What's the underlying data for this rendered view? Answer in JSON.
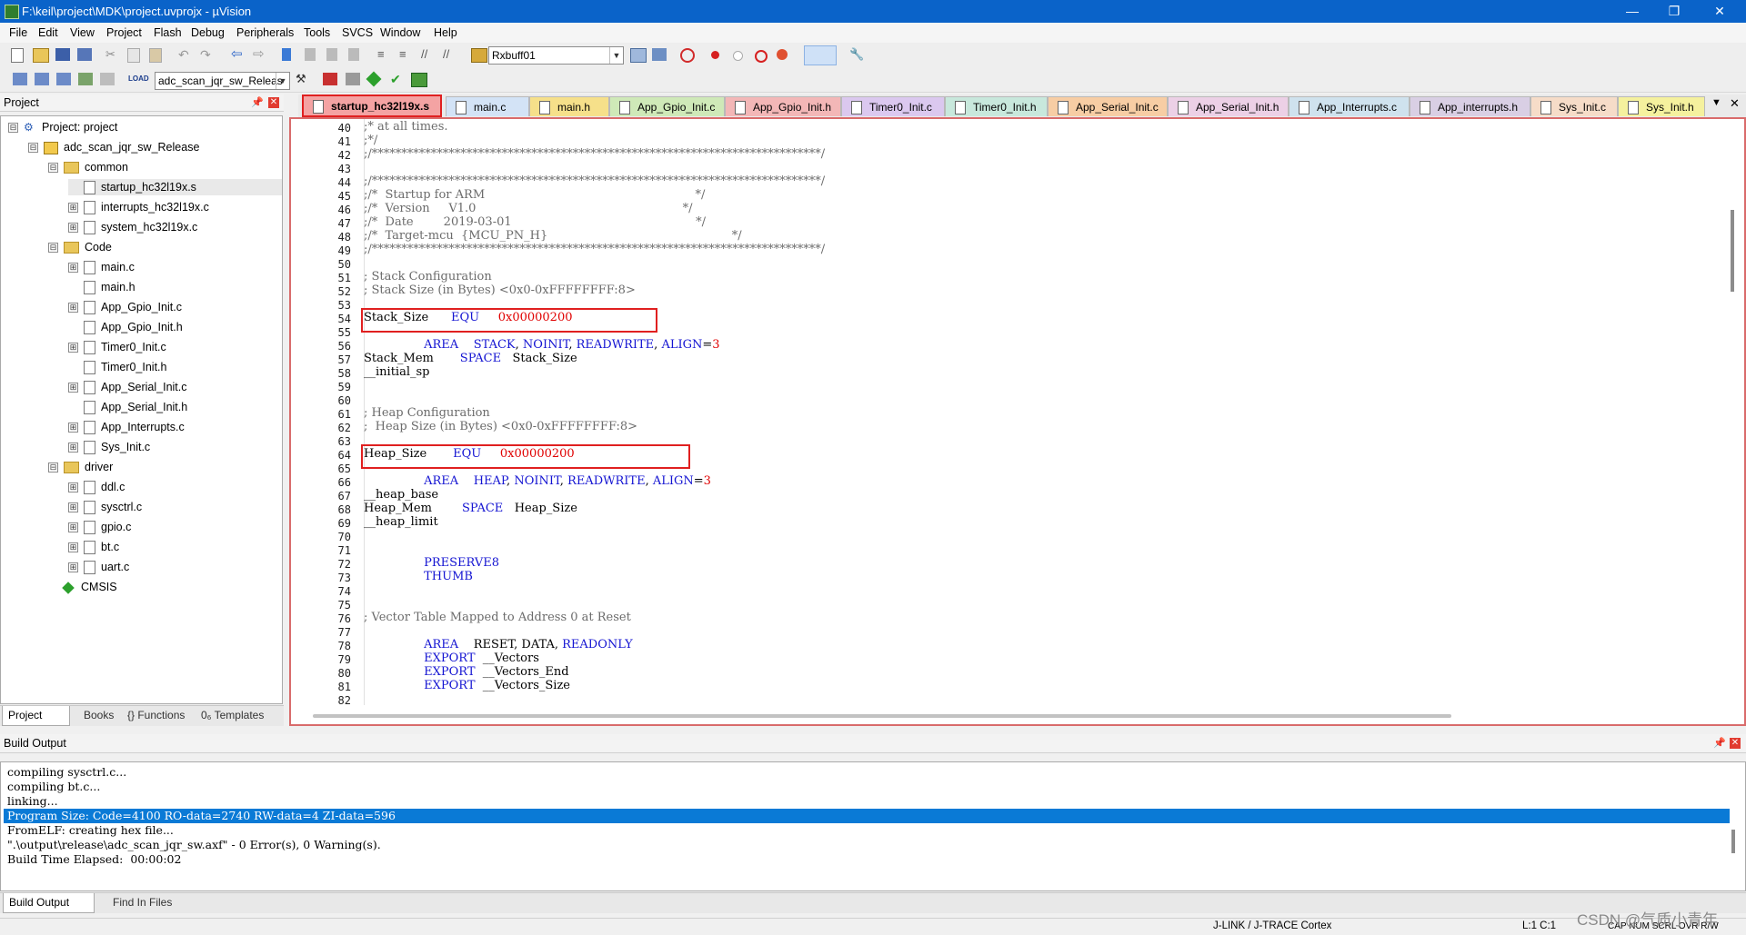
{
  "window": {
    "title": "F:\\keil\\project\\MDK\\project.uvprojx - µVision",
    "minimize": "—",
    "maximize": "❐",
    "close": "✕"
  },
  "menu": [
    "File",
    "Edit",
    "View",
    "Project",
    "Flash",
    "Debug",
    "Peripherals",
    "Tools",
    "SVCS",
    "Window",
    "Help"
  ],
  "toolbar1": {
    "find_value": "Rxbuff01"
  },
  "toolbar2": {
    "target_value": "adc_scan_jqr_sw_Releas",
    "load_label": "LOAD"
  },
  "project_panel": {
    "title": "Project",
    "tree": [
      {
        "label": "Project: project",
        "kind": "project",
        "expander": "⊟"
      },
      {
        "label": "adc_scan_jqr_sw_Release",
        "kind": "target",
        "expander": "⊟"
      },
      {
        "label": "common",
        "kind": "folder",
        "expander": "⊟"
      },
      {
        "label": "startup_hc32l19x.s",
        "kind": "file",
        "expander": ""
      },
      {
        "label": "interrupts_hc32l19x.c",
        "kind": "file",
        "expander": "⊞"
      },
      {
        "label": "system_hc32l19x.c",
        "kind": "file",
        "expander": "⊞"
      },
      {
        "label": "Code",
        "kind": "folder",
        "expander": "⊟"
      },
      {
        "label": "main.c",
        "kind": "file",
        "expander": "⊞"
      },
      {
        "label": "main.h",
        "kind": "file",
        "expander": ""
      },
      {
        "label": "App_Gpio_Init.c",
        "kind": "file",
        "expander": "⊞"
      },
      {
        "label": "App_Gpio_Init.h",
        "kind": "file",
        "expander": ""
      },
      {
        "label": "Timer0_Init.c",
        "kind": "file",
        "expander": "⊞"
      },
      {
        "label": "Timer0_Init.h",
        "kind": "file",
        "expander": ""
      },
      {
        "label": "App_Serial_Init.c",
        "kind": "file",
        "expander": "⊞"
      },
      {
        "label": "App_Serial_Init.h",
        "kind": "file",
        "expander": ""
      },
      {
        "label": "App_Interrupts.c",
        "kind": "file",
        "expander": "⊞"
      },
      {
        "label": "Sys_Init.c",
        "kind": "file",
        "expander": "⊞"
      },
      {
        "label": "driver",
        "kind": "folder",
        "expander": "⊟"
      },
      {
        "label": "ddl.c",
        "kind": "file",
        "expander": "⊞"
      },
      {
        "label": "sysctrl.c",
        "kind": "file",
        "expander": "⊞"
      },
      {
        "label": "gpio.c",
        "kind": "file",
        "expander": "⊞"
      },
      {
        "label": "bt.c",
        "kind": "file",
        "expander": "⊞"
      },
      {
        "label": "uart.c",
        "kind": "file",
        "expander": "⊞"
      },
      {
        "label": "CMSIS",
        "kind": "cmsis",
        "expander": ""
      }
    ],
    "bottom_tabs": [
      "Project",
      "Books",
      "{} Functions",
      "0₆ Templates"
    ]
  },
  "file_tabs": [
    {
      "label": "startup_hc32l19x.s",
      "color": "#f4a3a3",
      "active": true
    },
    {
      "label": "main.c",
      "color": "#d3e3f6"
    },
    {
      "label": "main.h",
      "color": "#f6e08a"
    },
    {
      "label": "App_Gpio_Init.c",
      "color": "#cfe9b8"
    },
    {
      "label": "App_Gpio_Init.h",
      "color": "#f3b7b7"
    },
    {
      "label": "Timer0_Init.c",
      "color": "#dbc8ef"
    },
    {
      "label": "Timer0_Init.h",
      "color": "#c8e8dc"
    },
    {
      "label": "App_Serial_Init.c",
      "color": "#f7cda4"
    },
    {
      "label": "App_Serial_Init.h",
      "color": "#ecd0e6"
    },
    {
      "label": "App_Interrupts.c",
      "color": "#cfe2ee"
    },
    {
      "label": "App_interrupts.h",
      "color": "#d9cfe4"
    },
    {
      "label": "Sys_Init.c",
      "color": "#f6dcc8"
    },
    {
      "label": "Sys_Init.h",
      "color": "#f5f19e"
    }
  ],
  "editor": {
    "lines": [
      {
        "n": "40",
        "parts": [
          {
            "t": ";* at all times.",
            "c": "cm"
          }
        ]
      },
      {
        "n": "41",
        "parts": [
          {
            "t": ";*/",
            "c": "cm"
          }
        ]
      },
      {
        "n": "42",
        "parts": [
          {
            "t": ";/****************************************************************************/",
            "c": "cm"
          }
        ]
      },
      {
        "n": "43",
        "parts": []
      },
      {
        "n": "44",
        "parts": [
          {
            "t": ";/****************************************************************************/",
            "c": "cm"
          }
        ]
      },
      {
        "n": "45",
        "parts": [
          {
            "t": ";/*  Startup for ARM                                                        */",
            "c": "cm"
          }
        ]
      },
      {
        "n": "46",
        "parts": [
          {
            "t": ";/*  Version     V1.0                                                       */",
            "c": "cm"
          }
        ]
      },
      {
        "n": "47",
        "parts": [
          {
            "t": ";/*  Date        2019-03-01                                                 */",
            "c": "cm"
          }
        ]
      },
      {
        "n": "48",
        "parts": [
          {
            "t": ";/*  Target-mcu  {MCU_PN_H}                                                 */",
            "c": "cm"
          }
        ]
      },
      {
        "n": "49",
        "parts": [
          {
            "t": ";/****************************************************************************/",
            "c": "cm"
          }
        ]
      },
      {
        "n": "50",
        "parts": []
      },
      {
        "n": "51",
        "parts": [
          {
            "t": "; Stack Configuration",
            "c": "cm"
          }
        ]
      },
      {
        "n": "52",
        "parts": [
          {
            "t": "; Stack Size (in Bytes) <0x0-0xFFFFFFFF:8>",
            "c": "cm"
          }
        ]
      },
      {
        "n": "53",
        "parts": []
      },
      {
        "n": "54",
        "parts": [
          {
            "t": "Stack_Size      ",
            "c": ""
          },
          {
            "t": "EQU     ",
            "c": "kw"
          },
          {
            "t": "0x00000200",
            "c": "nm"
          }
        ]
      },
      {
        "n": "55",
        "parts": []
      },
      {
        "n": "56",
        "parts": [
          {
            "t": "                ",
            "c": ""
          },
          {
            "t": "AREA",
            "c": "kw"
          },
          {
            "t": "    ",
            "c": ""
          },
          {
            "t": "STACK",
            "c": "kw"
          },
          {
            "t": ", ",
            "c": ""
          },
          {
            "t": "NOINIT",
            "c": "kw"
          },
          {
            "t": ", ",
            "c": ""
          },
          {
            "t": "READWRITE",
            "c": "kw"
          },
          {
            "t": ", ",
            "c": ""
          },
          {
            "t": "ALIGN",
            "c": "kw"
          },
          {
            "t": "=",
            "c": ""
          },
          {
            "t": "3",
            "c": "nm"
          }
        ]
      },
      {
        "n": "57",
        "parts": [
          {
            "t": "Stack_Mem       ",
            "c": ""
          },
          {
            "t": "SPACE",
            "c": "kw"
          },
          {
            "t": "   Stack_Size",
            "c": ""
          }
        ]
      },
      {
        "n": "58",
        "parts": [
          {
            "t": "__initial_sp",
            "c": ""
          }
        ]
      },
      {
        "n": "59",
        "parts": []
      },
      {
        "n": "60",
        "parts": []
      },
      {
        "n": "61",
        "parts": [
          {
            "t": "; Heap Configuration",
            "c": "cm"
          }
        ]
      },
      {
        "n": "62",
        "parts": [
          {
            "t": ";  Heap Size (in Bytes) <0x0-0xFFFFFFFF:8>",
            "c": "cm"
          }
        ]
      },
      {
        "n": "63",
        "parts": []
      },
      {
        "n": "64",
        "parts": [
          {
            "t": "Heap_Size       ",
            "c": ""
          },
          {
            "t": "EQU     ",
            "c": "kw"
          },
          {
            "t": "0x00000200",
            "c": "nm"
          }
        ]
      },
      {
        "n": "65",
        "parts": []
      },
      {
        "n": "66",
        "parts": [
          {
            "t": "                ",
            "c": ""
          },
          {
            "t": "AREA",
            "c": "kw"
          },
          {
            "t": "    ",
            "c": ""
          },
          {
            "t": "HEAP",
            "c": "kw"
          },
          {
            "t": ", ",
            "c": ""
          },
          {
            "t": "NOINIT",
            "c": "kw"
          },
          {
            "t": ", ",
            "c": ""
          },
          {
            "t": "READWRITE",
            "c": "kw"
          },
          {
            "t": ", ",
            "c": ""
          },
          {
            "t": "ALIGN",
            "c": "kw"
          },
          {
            "t": "=",
            "c": ""
          },
          {
            "t": "3",
            "c": "nm"
          }
        ]
      },
      {
        "n": "67",
        "parts": [
          {
            "t": "__heap_base",
            "c": ""
          }
        ]
      },
      {
        "n": "68",
        "parts": [
          {
            "t": "Heap_Mem        ",
            "c": ""
          },
          {
            "t": "SPACE",
            "c": "kw"
          },
          {
            "t": "   Heap_Size",
            "c": ""
          }
        ]
      },
      {
        "n": "69",
        "parts": [
          {
            "t": "__heap_limit",
            "c": ""
          }
        ]
      },
      {
        "n": "70",
        "parts": []
      },
      {
        "n": "71",
        "parts": []
      },
      {
        "n": "72",
        "parts": [
          {
            "t": "                ",
            "c": ""
          },
          {
            "t": "PRESERVE8",
            "c": "kw"
          }
        ]
      },
      {
        "n": "73",
        "parts": [
          {
            "t": "                ",
            "c": ""
          },
          {
            "t": "THUMB",
            "c": "kw"
          }
        ]
      },
      {
        "n": "74",
        "parts": []
      },
      {
        "n": "75",
        "parts": []
      },
      {
        "n": "76",
        "parts": [
          {
            "t": "; Vector Table Mapped to Address 0 at Reset",
            "c": "cm"
          }
        ]
      },
      {
        "n": "77",
        "parts": []
      },
      {
        "n": "78",
        "parts": [
          {
            "t": "                ",
            "c": ""
          },
          {
            "t": "AREA",
            "c": "kw"
          },
          {
            "t": "    RESET, DATA, ",
            "c": ""
          },
          {
            "t": "READONLY",
            "c": "kw"
          }
        ]
      },
      {
        "n": "79",
        "parts": [
          {
            "t": "                ",
            "c": ""
          },
          {
            "t": "EXPORT",
            "c": "kw"
          },
          {
            "t": "  __Vectors",
            "c": ""
          }
        ]
      },
      {
        "n": "80",
        "parts": [
          {
            "t": "                ",
            "c": ""
          },
          {
            "t": "EXPORT",
            "c": "kw"
          },
          {
            "t": "  __Vectors_End",
            "c": ""
          }
        ]
      },
      {
        "n": "81",
        "parts": [
          {
            "t": "                ",
            "c": ""
          },
          {
            "t": "EXPORT",
            "c": "kw"
          },
          {
            "t": "  __Vectors_Size",
            "c": ""
          }
        ]
      },
      {
        "n": "82",
        "parts": []
      }
    ],
    "highlighted_lines": [
      "54",
      "64"
    ]
  },
  "build_output": {
    "title": "Build Output",
    "lines": [
      "compiling sysctrl.c...",
      "compiling bt.c...",
      "linking...",
      "Program Size: Code=4100 RO-data=2740 RW-data=4 ZI-data=596",
      "FromELF: creating hex file...",
      "\".\\output\\release\\adc_scan_jqr_sw.axf\" - 0 Error(s), 0 Warning(s).",
      "Build Time Elapsed:  00:00:02"
    ],
    "selected_index": 3,
    "bottom_tabs": [
      "Build Output",
      "Find In Files"
    ]
  },
  "status": {
    "debugger": "J-LINK / J-TRACE Cortex",
    "position": "L:1 C:1",
    "flags": "CAP  NUM  SCRL  OVR  R/W"
  },
  "watermark": "CSDN @气质小青年"
}
